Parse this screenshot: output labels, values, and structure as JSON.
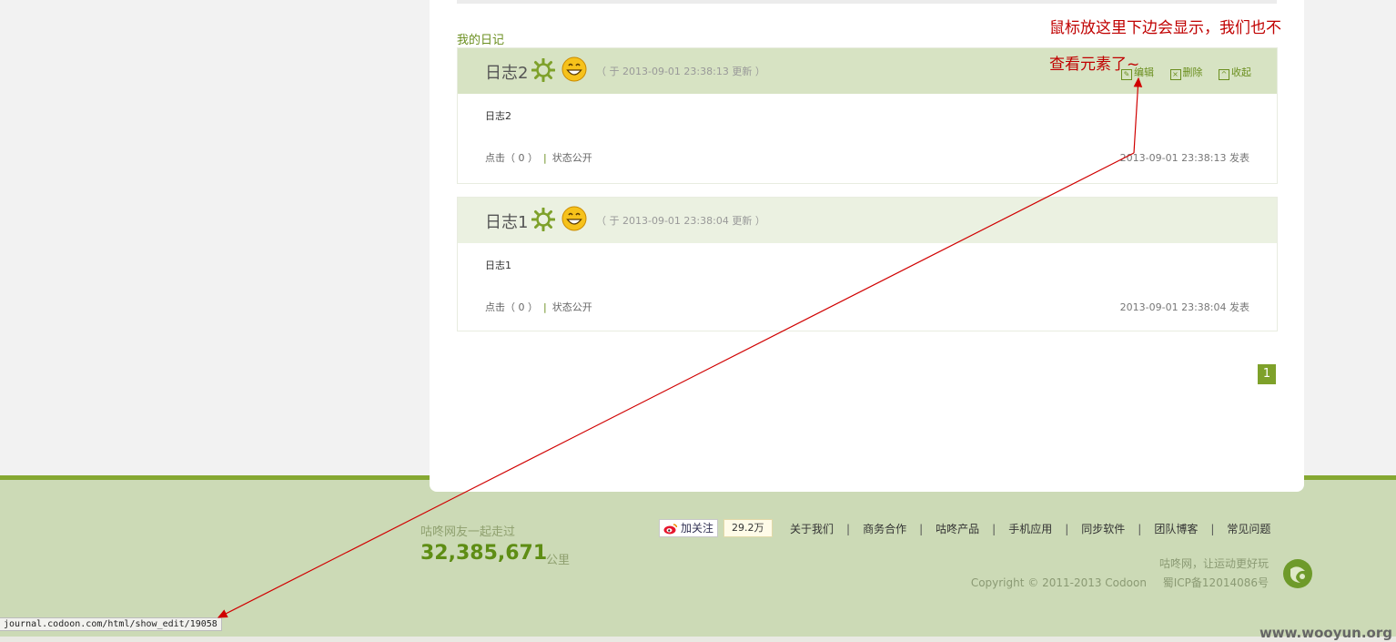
{
  "section_title": "我的日记",
  "entries": [
    {
      "title": "日志2",
      "updated": "（ 于 2013-09-01 23:38:13 更新 ）",
      "actions": {
        "edit": "编辑",
        "delete": "删除",
        "collapse": "收起"
      },
      "body": "日志2",
      "clicks": "点击（ 0 ）",
      "status": "状态公开",
      "published": "2013-09-01 23:38:13 发表"
    },
    {
      "title": "日志1",
      "updated": "（ 于 2013-09-01 23:38:04 更新 ）",
      "body": "日志1",
      "clicks": "点击（ 0 ）",
      "status": "状态公开",
      "published": "2013-09-01 23:38:04 发表"
    }
  ],
  "pagination": {
    "current_page": "1"
  },
  "footer": {
    "stat_label": "咕咚网友一起走过",
    "stat_value": "32,385,671",
    "stat_unit": "公里",
    "weibo_follow": "加关注",
    "weibo_count": "29.2万",
    "nav": [
      "关于我们",
      "商务合作",
      "咕咚产品",
      "手机应用",
      "同步软件",
      "团队博客",
      "常见问题"
    ],
    "nav_separator": "|",
    "slogan": "咕咚网，让运动更好玩",
    "copyright": "Copyright © 2011-2013 Codoon",
    "icp": "蜀ICP备12014086号"
  },
  "status_bar_url": "journal.codoon.com/html/show_edit/19058",
  "watermark": "www.wooyun.org",
  "annotation": {
    "line1": "鼠标放这里下边会显示，我们也不",
    "line2": "查看元素了~"
  },
  "colors": {
    "accent_green": "#6a8e1e",
    "header_active": "#d7e3c3",
    "header_inactive": "#ebf1e1",
    "footer_bg": "#ccdab6",
    "annotation_red": "#c00000"
  },
  "icons": [
    "sun-icon",
    "smile-emoji-icon",
    "edit-icon",
    "delete-icon",
    "collapse-icon",
    "weibo-icon",
    "codoon-logo-icon"
  ]
}
